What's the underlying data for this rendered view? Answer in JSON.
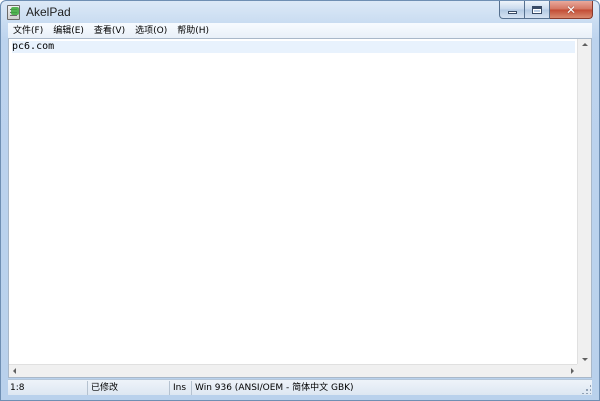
{
  "window": {
    "title": "AkelPad",
    "caption": {
      "minimize": "minimize-icon",
      "maximize": "maximize-icon",
      "close_glyph": "✕"
    }
  },
  "menu": {
    "items": [
      {
        "label": "文件(F)"
      },
      {
        "label": "编辑(E)"
      },
      {
        "label": "查看(V)"
      },
      {
        "label": "选项(O)"
      },
      {
        "label": "帮助(H)"
      }
    ]
  },
  "editor": {
    "lines": [
      "pc6.com"
    ]
  },
  "status": {
    "position": "1:8",
    "modified": "已修改",
    "insert_mode": "Ins",
    "encoding": "Win  936  (ANSI/OEM - 简体中文 GBK)"
  },
  "colors": {
    "frame": "#c9dcf1",
    "close_button": "#c24a33",
    "current_line": "#e8f2fd"
  }
}
